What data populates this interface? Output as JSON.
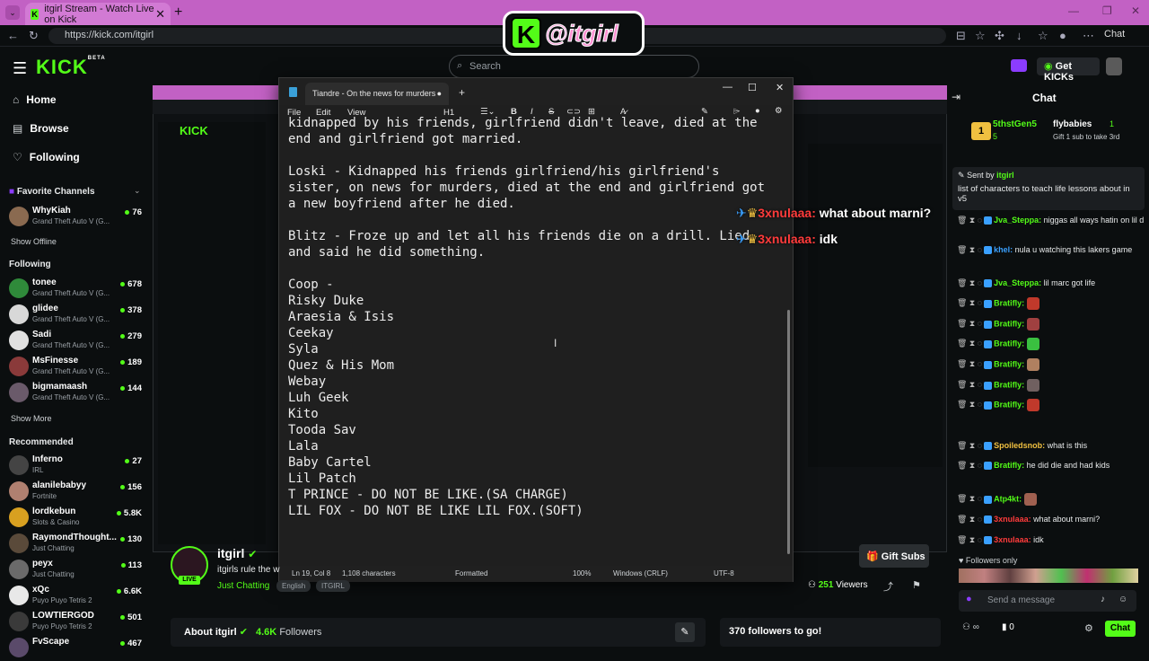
{
  "browser": {
    "tab_title": "itgirl Stream - Watch Live on Kick",
    "url": "https://kick.com/itgirl",
    "chat_label": "Chat"
  },
  "sticker": {
    "k": "K",
    "name": "@itgirl"
  },
  "header": {
    "logo": "KICK",
    "logo_beta": "BETA",
    "search_placeholder": "Search",
    "get_kicks": "Get KICKs"
  },
  "sidebar": {
    "nav": [
      {
        "icon": "⌂",
        "label": "Home"
      },
      {
        "icon": "▤",
        "label": "Browse"
      },
      {
        "icon": "♡",
        "label": "Following"
      }
    ],
    "favorite_header": "Favorite Channels",
    "favorites": [
      {
        "name": "WhyKiah",
        "game": "Grand Theft Auto V (G...",
        "viewers": "76",
        "color": "#8a6a50"
      }
    ],
    "show_offline": "Show Offline",
    "following_header": "Following",
    "following": [
      {
        "name": "tonee",
        "game": "Grand Theft Auto V (G...",
        "viewers": "678",
        "color": "#2f8a3a"
      },
      {
        "name": "glidee",
        "game": "Grand Theft Auto V (G...",
        "viewers": "378",
        "color": "#d8d8d8"
      },
      {
        "name": "Sadi",
        "game": "Grand Theft Auto V (G...",
        "viewers": "279",
        "color": "#e0e0e0"
      },
      {
        "name": "MsFinesse",
        "game": "Grand Theft Auto V (G...",
        "viewers": "189",
        "color": "#8a3a3a"
      },
      {
        "name": "bigmamaash",
        "game": "Grand Theft Auto V (G...",
        "viewers": "144",
        "color": "#6a5a6a"
      }
    ],
    "show_more": "Show More",
    "recommended_header": "Recommended",
    "recommended": [
      {
        "name": "Inferno",
        "game": "IRL",
        "viewers": "27",
        "color": "#444"
      },
      {
        "name": "alanilebabyy",
        "game": "Fortnite",
        "viewers": "156",
        "color": "#b08070"
      },
      {
        "name": "lordkebun",
        "game": "Slots & Casino",
        "viewers": "5.8K",
        "color": "#d8a020"
      },
      {
        "name": "RaymondThought...",
        "game": "Just Chatting",
        "viewers": "130",
        "color": "#5a4a3a"
      },
      {
        "name": "peyx",
        "game": "Just Chatting",
        "viewers": "113",
        "color": "#6a6a6a"
      },
      {
        "name": "xQc",
        "game": "Puyo Puyo Tetris 2",
        "viewers": "6.6K",
        "color": "#e8e8e8"
      },
      {
        "name": "LOWTIERGOD",
        "game": "Puyo Puyo Tetris 2",
        "viewers": "501",
        "color": "#3a3a3a"
      },
      {
        "name": "FvScape",
        "game": "",
        "viewers": "467",
        "color": "#5a4a6a"
      }
    ]
  },
  "notepad": {
    "tab_title": "Tiandre - On the news for murders",
    "menu": [
      "File",
      "Edit",
      "View"
    ],
    "heading_style": "H1",
    "text": "kidnapped by his friends, girlfriend didn't leave, died at the\nend and girlfriend got married.\n\nLoski - Kidnapped his friends girlfriend/his girlfriend's\nsister, on news for murders, died at the end and girlfriend got\na new boyfriend after he died.\n\nBlitz - Froze up and let all his friends die on a drill. Lied\nand said he did something.\n\nCoop -\nRisky Duke\nAraesia & Isis\nCeekay\nSyla\nQuez & His Mom\nWebay\nLuh Geek\nKito\nTooda Sav\nLala\nBaby Cartel\nLil Patch\nT PRINCE - DO NOT BE LIKE.(SA CHARGE)\nLIL FOX - DO NOT BE LIKE LIL FOX.(SOFT)",
    "status": {
      "position": "Ln 19, Col 8",
      "chars": "1,108 characters",
      "format": "Formatted",
      "zoom": "100%",
      "eol": "Windows (CRLF)",
      "encoding": "UTF-8"
    }
  },
  "overlay": [
    {
      "user": "3xnulaaa:",
      "msg": "what about marni?"
    },
    {
      "user": "3xnulaaa:",
      "msg": "idk"
    }
  ],
  "chat": {
    "title": "Chat",
    "gifter": {
      "name": "5thstGen5",
      "count": "5",
      "other": "flybabies",
      "other_count": "1",
      "line": "Gift 1 sub to take 3rd"
    },
    "pinned": {
      "sent_by": "Sent by",
      "user": "itgirl",
      "text": "list of characters to teach life lessons about in v5"
    },
    "messages": [
      {
        "user": "Jva_Steppa:",
        "color": "#53fc18",
        "text": "niggas all ways hatin on lil d",
        "emote": ""
      },
      {
        "user": "khel:",
        "color": "#3aa0ff",
        "text": "nula u watching this lakers game",
        "emote": ""
      },
      {
        "user": "Jva_Steppa:",
        "color": "#53fc18",
        "text": "lil marc got life",
        "emote": ""
      },
      {
        "user": "Bratifly:",
        "color": "#53fc18",
        "text": "",
        "emote": "#c0392b"
      },
      {
        "user": "Bratifly:",
        "color": "#53fc18",
        "text": "",
        "emote": "#a04040"
      },
      {
        "user": "Bratifly:",
        "color": "#53fc18",
        "text": "",
        "emote": "#3ac040"
      },
      {
        "user": "Bratifly:",
        "color": "#53fc18",
        "text": "",
        "emote": "#b08060"
      },
      {
        "user": "Bratifly:",
        "color": "#53fc18",
        "text": "",
        "emote": "#706060"
      },
      {
        "user": "Bratifly:",
        "color": "#53fc18",
        "text": "",
        "emote": "#c0392b"
      },
      {
        "user": "Spoiledsnob:",
        "color": "#f0c040",
        "text": "what is this",
        "emote": ""
      },
      {
        "user": "Bratifly:",
        "color": "#53fc18",
        "text": "he did die and had kids",
        "emote": ""
      },
      {
        "user": "Atp4kt:",
        "color": "#53fc18",
        "text": "",
        "emote": "#a06050"
      },
      {
        "user": "3xnulaaa:",
        "color": "#ff3b3b",
        "text": "what about marni?",
        "emote": ""
      },
      {
        "user": "3xnulaaa:",
        "color": "#ff3b3b",
        "text": "idk",
        "emote": ""
      }
    ],
    "followers_only": "Followers only",
    "input_placeholder": "Send a message",
    "points": "0",
    "send": "Chat"
  },
  "stream": {
    "streamer": "itgirl",
    "live": "LIVE",
    "title": "itgirls rule the w",
    "category": "Just Chatting",
    "tags": [
      "English",
      "ITGIRL"
    ],
    "gift_subs": "Gift Subs",
    "viewers": "251",
    "viewers_label": "Viewers",
    "about": "About itgirl",
    "followers": "4.6K",
    "followers_label": "Followers",
    "follow_goal": "370 followers to go!"
  }
}
